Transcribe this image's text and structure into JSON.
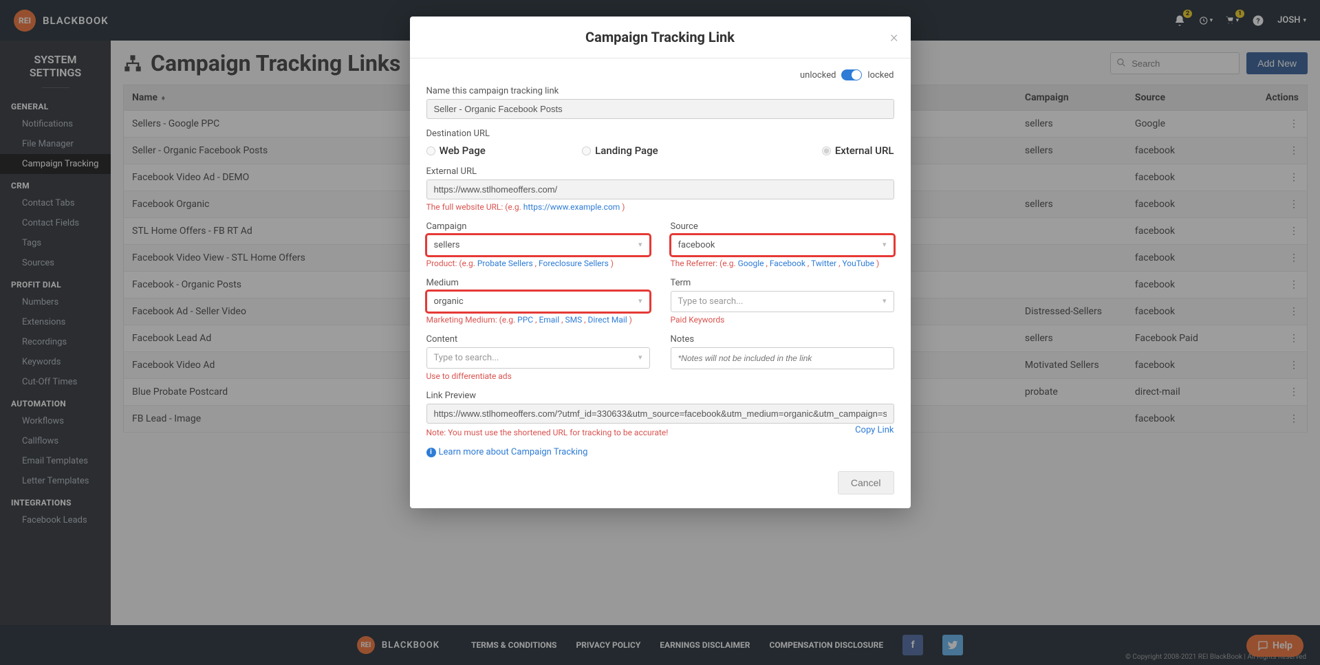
{
  "brand": {
    "logo": "REI",
    "name": "BLACKBOOK"
  },
  "topbar": {
    "notif_badge": "2",
    "cart_badge": "1",
    "user": "JOSH"
  },
  "sidebar": {
    "title": "SYSTEM SETTINGS",
    "sections": [
      {
        "label": "GENERAL",
        "items": [
          "Notifications",
          "File Manager",
          "Campaign Tracking"
        ]
      },
      {
        "label": "CRM",
        "items": [
          "Contact Tabs",
          "Contact Fields",
          "Tags",
          "Sources"
        ]
      },
      {
        "label": "PROFIT DIAL",
        "items": [
          "Numbers",
          "Extensions",
          "Recordings",
          "Keywords",
          "Cut-Off Times"
        ]
      },
      {
        "label": "AUTOMATION",
        "items": [
          "Workflows",
          "Callflows",
          "Email Templates",
          "Letter Templates"
        ]
      },
      {
        "label": "INTEGRATIONS",
        "items": [
          "Facebook Leads"
        ]
      }
    ],
    "active": "Campaign Tracking"
  },
  "page": {
    "title": "Campaign Tracking Links",
    "search_placeholder": "Search",
    "add_new": "Add New"
  },
  "table": {
    "headers": [
      "Name",
      "Campaign",
      "Source",
      "Actions"
    ],
    "rows": [
      {
        "name": "Sellers - Google PPC",
        "campaign": "sellers",
        "source": "Google"
      },
      {
        "name": "Seller - Organic Facebook Posts",
        "campaign": "sellers",
        "source": "facebook"
      },
      {
        "name": "Facebook Video Ad - DEMO",
        "campaign": "",
        "source": "facebook"
      },
      {
        "name": "Facebook Organic",
        "campaign": "sellers",
        "source": "facebook"
      },
      {
        "name": "STL Home Offers - FB RT Ad",
        "campaign": "",
        "source": "facebook"
      },
      {
        "name": "Facebook Video View - STL Home Offers",
        "campaign": "",
        "source": "facebook"
      },
      {
        "name": "Facebook - Organic Posts",
        "campaign": "",
        "source": "facebook"
      },
      {
        "name": "Facebook Ad - Seller Video",
        "campaign": "Distressed-Sellers",
        "source": "facebook"
      },
      {
        "name": "Facebook Lead Ad",
        "campaign": "sellers",
        "source": "Facebook Paid"
      },
      {
        "name": "Facebook Video Ad",
        "campaign": "Motivated Sellers",
        "source": "facebook"
      },
      {
        "name": "Blue Probate Postcard",
        "campaign": "probate",
        "source": "direct-mail"
      },
      {
        "name": "FB Lead - Image",
        "campaign": "",
        "source": "facebook"
      }
    ]
  },
  "modal": {
    "title": "Campaign Tracking Link",
    "unlocked": "unlocked",
    "locked": "locked",
    "name_label": "Name this campaign tracking link",
    "name_value": "Seller - Organic Facebook Posts",
    "dest_url_label": "Destination URL",
    "dest_opts": {
      "web": "Web Page",
      "landing": "Landing Page",
      "external": "External URL"
    },
    "external_url_label": "External URL",
    "external_url_value": "https://www.stlhomeoffers.com/",
    "url_hint_prefix": "The full website URL: (e.g. ",
    "url_hint_link": "https://www.example.com",
    "campaign_label": "Campaign",
    "campaign_value": "sellers",
    "campaign_hint": "Product: (e.g. ",
    "campaign_hint_links": [
      "Probate Sellers",
      "Foreclosure Sellers"
    ],
    "source_label": "Source",
    "source_value": "facebook",
    "source_hint": "The Referrer: (e.g. ",
    "source_hint_links": [
      "Google",
      "Facebook",
      "Twitter",
      "YouTube"
    ],
    "medium_label": "Medium",
    "medium_value": "organic",
    "medium_hint": "Marketing Medium: (e.g. ",
    "medium_hint_links": [
      "PPC",
      "Email",
      "SMS",
      "Direct Mail"
    ],
    "term_label": "Term",
    "term_placeholder": "Type to search...",
    "term_hint": "Paid Keywords",
    "content_label": "Content",
    "content_placeholder": "Type to search...",
    "content_hint": "Use to differentiate ads",
    "notes_label": "Notes",
    "notes_placeholder": "*Notes will not be included in the link",
    "preview_label": "Link Preview",
    "preview_value": "https://www.stlhomeoffers.com/?utmf_id=330633&utm_source=facebook&utm_medium=organic&utm_campaign=sellers",
    "preview_hint": "Note: You must use the shortened URL for tracking to be accurate!",
    "copy_link": "Copy Link",
    "learn_more": "Learn more about Campaign Tracking",
    "cancel": "Cancel"
  },
  "footer": {
    "links": [
      "TERMS & CONDITIONS",
      "PRIVACY POLICY",
      "EARNINGS DISCLAIMER",
      "COMPENSATION DISCLOSURE"
    ],
    "copyright": "© Copyright 2008-2021 REI BlackBook | All Rights Reserved",
    "help": "Help"
  }
}
